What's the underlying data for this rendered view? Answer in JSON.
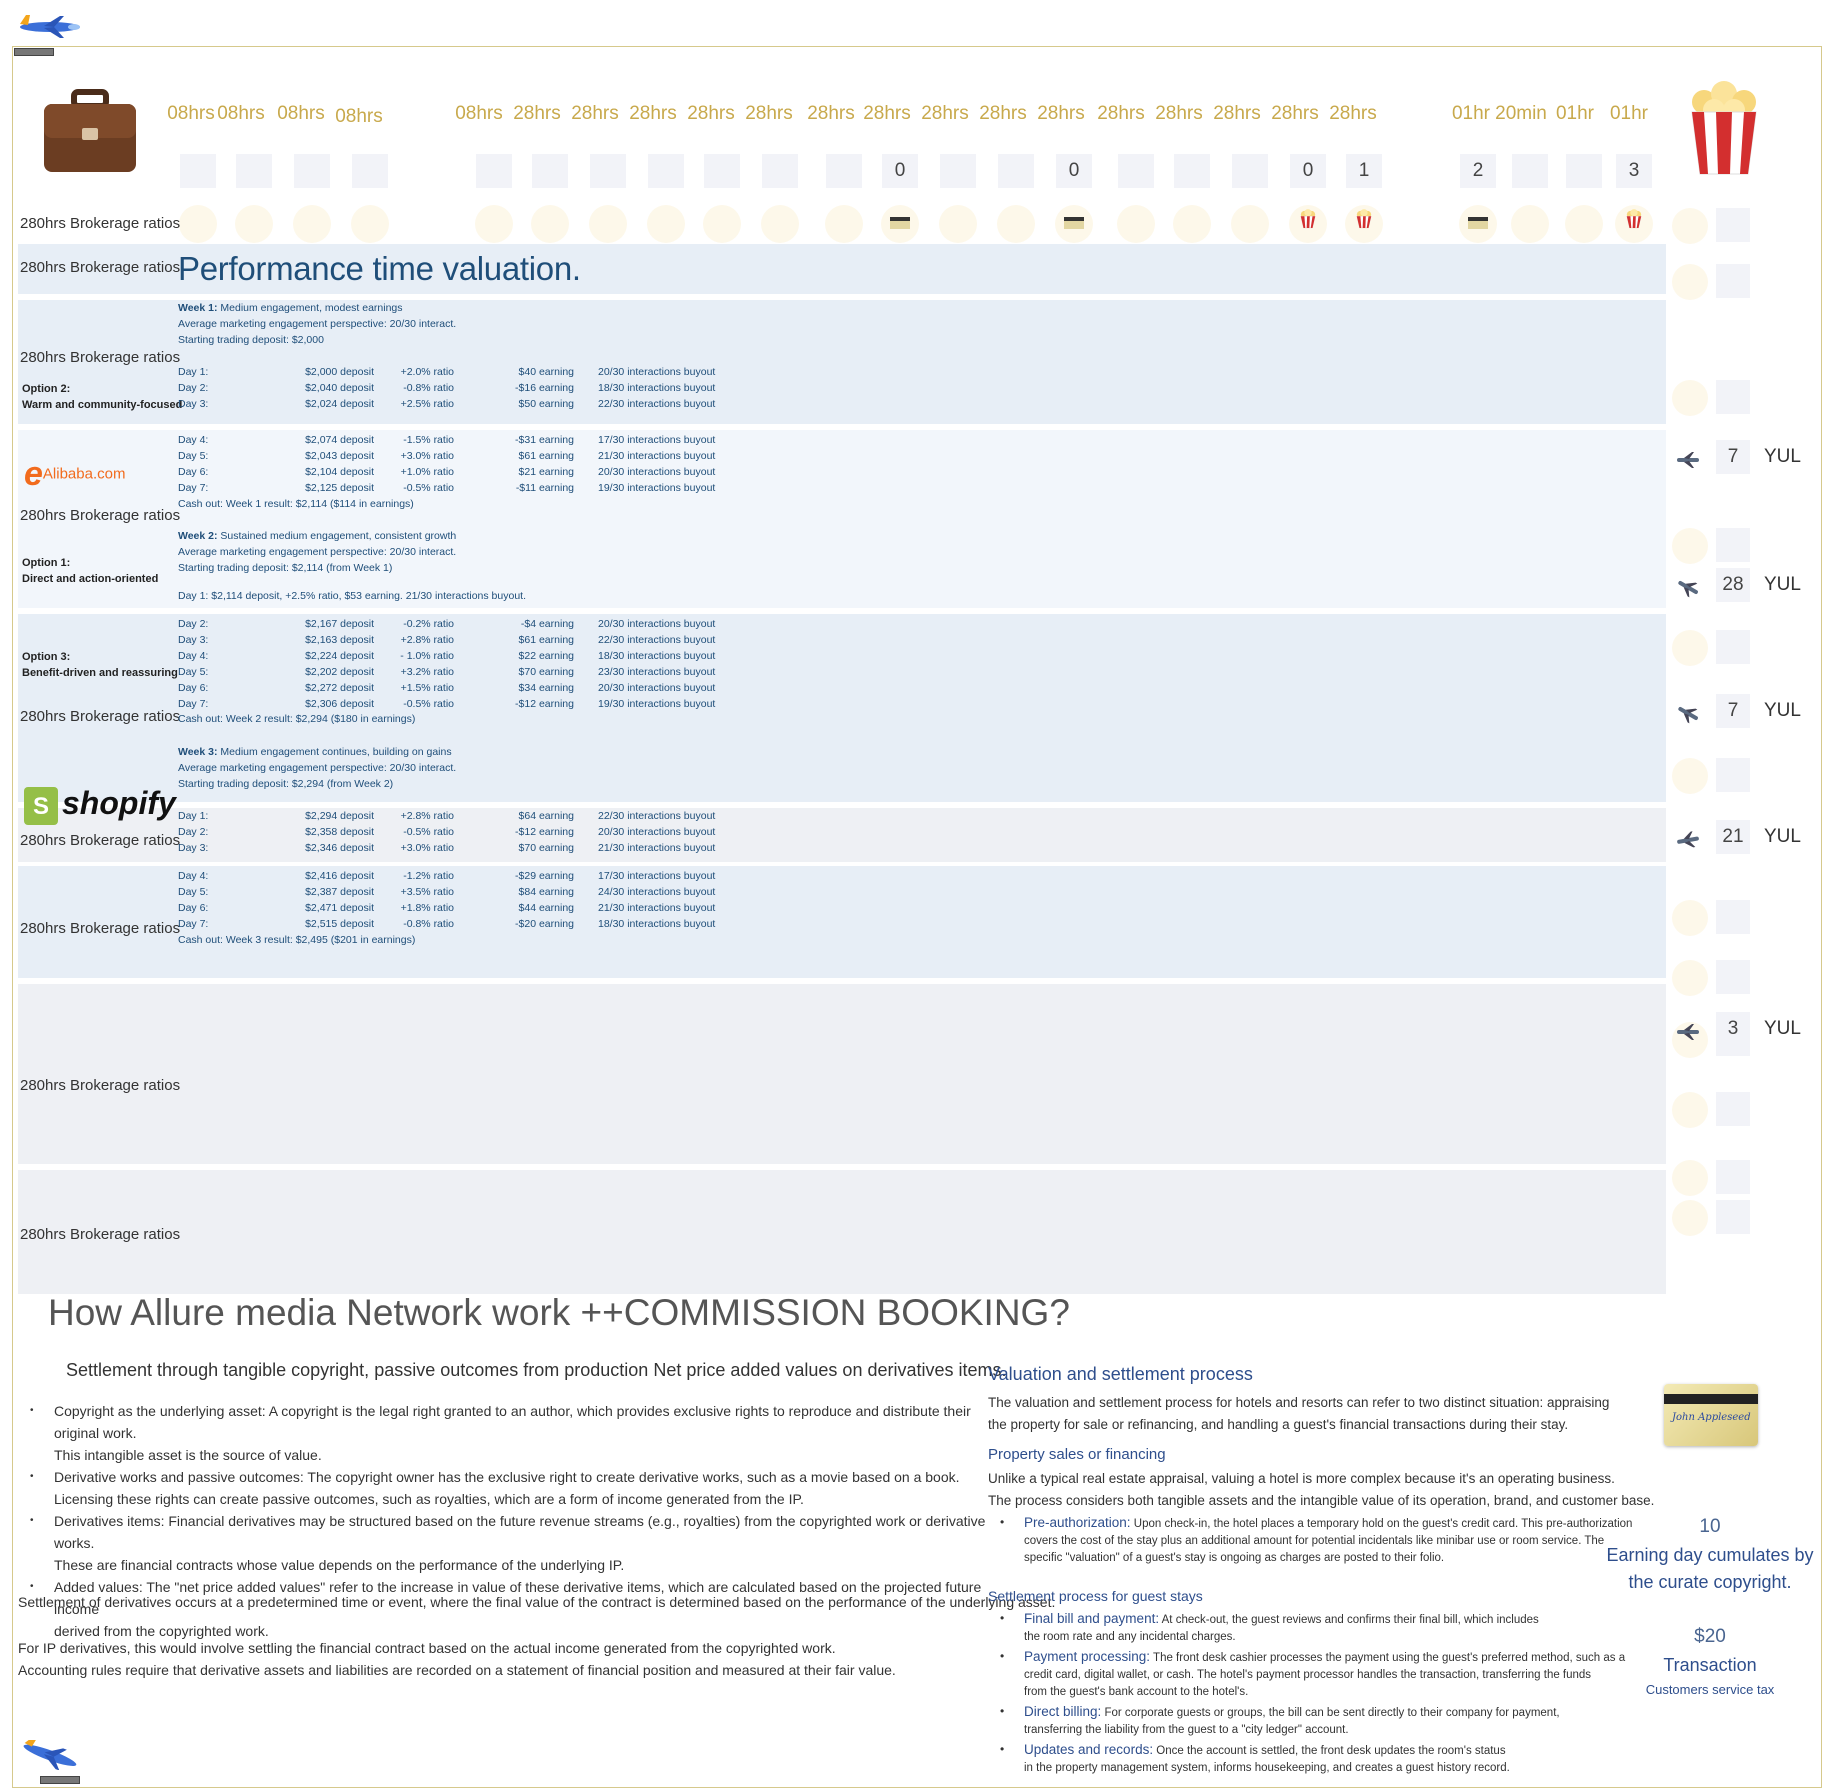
{
  "header": {
    "hours": [
      "08hrs",
      "08hrs",
      "08hrs",
      "08hrs",
      "08hrs",
      "28hrs",
      "28hrs",
      "28hrs",
      "28hrs",
      "28hrs",
      "28hrs",
      "28hrs",
      "28hrs",
      "28hrs",
      "28hrs",
      "28hrs",
      "28hrs",
      "28hrs",
      "28hrs",
      "28hrs",
      "01hr",
      "20min",
      "01hr",
      "01hr"
    ],
    "counters": [
      "0",
      "0",
      "0",
      "1",
      "2",
      "3"
    ],
    "briefcase_icon": "briefcase-icon",
    "popcorn_icon": "popcorn-icon"
  },
  "row_label": "280hrs Brokerage ratios",
  "options": {
    "opt2": {
      "title": "Option 2:",
      "desc": "Warm and community-focused"
    },
    "opt1": {
      "title": "Option 1:",
      "desc": "Direct and action-oriented"
    },
    "opt3": {
      "title": "Option 3:",
      "desc": "Benefit-driven and reassuring"
    }
  },
  "logos": {
    "alibaba": "Alibaba.com",
    "shopify": "shopify"
  },
  "performance_title": "Performance time valuation.",
  "week1": {
    "label": "Week 1:",
    "summary": "Medium engagement, modest earnings",
    "perspective": "Average marketing engagement perspective: 20/30 interact.",
    "deposit": "Starting trading deposit: $2,000",
    "days": [
      {
        "day": "Day 1:",
        "dep": "$2,000 deposit",
        "ratio": "+2.0% ratio",
        "earn": "$40 earning",
        "int": "20/30 interactions buyout"
      },
      {
        "day": "Day 2:",
        "dep": "$2,040 deposit",
        "ratio": "-0.8% ratio",
        "earn": "-$16 earning",
        "int": "18/30 interactions buyout"
      },
      {
        "day": "Day 3:",
        "dep": "$2,024 deposit",
        "ratio": "+2.5% ratio",
        "earn": "$50 earning",
        "int": "22/30 interactions buyout"
      },
      {
        "day": "Day 4:",
        "dep": "$2,074 deposit",
        "ratio": "-1.5% ratio",
        "earn": "-$31 earning",
        "int": "17/30 interactions buyout"
      },
      {
        "day": "Day 5:",
        "dep": "$2,043 deposit",
        "ratio": "+3.0% ratio",
        "earn": "$61 earning",
        "int": "21/30 interactions buyout"
      },
      {
        "day": "Day 6:",
        "dep": "$2,104 deposit",
        "ratio": "+1.0% ratio",
        "earn": "$21 earning",
        "int": "20/30 interactions buyout"
      },
      {
        "day": "Day 7:",
        "dep": "$2,125 deposit",
        "ratio": "-0.5% ratio",
        "earn": "-$11 earning",
        "int": "19/30 interactions buyout"
      }
    ],
    "cashout": "Cash out: Week 1 result: $2,114 ($114 in earnings)"
  },
  "week2": {
    "label": "Week 2:",
    "summary": "Sustained medium engagement, consistent growth",
    "perspective": "Average marketing engagement perspective: 20/30 interact.",
    "deposit": "Starting trading deposit: $2,114 (from Week 1)",
    "day1": "Day 1: $2,114 deposit, +2.5% ratio, $53 earning. 21/30 interactions buyout.",
    "days": [
      {
        "day": "Day 2:",
        "dep": "$2,167 deposit",
        "ratio": "-0.2% ratio",
        "earn": "-$4 earning",
        "int": "20/30 interactions buyout"
      },
      {
        "day": "Day 3:",
        "dep": "$2,163 deposit",
        "ratio": "+2.8% ratio",
        "earn": "$61 earning",
        "int": "22/30 interactions buyout"
      },
      {
        "day": "Day 4:",
        "dep": "$2,224 deposit",
        "ratio": "- 1.0% ratio",
        "earn": "$22 earning",
        "int": "18/30 interactions buyout"
      },
      {
        "day": "Day 5:",
        "dep": "$2,202 deposit",
        "ratio": "+3.2% ratio",
        "earn": "$70 earning",
        "int": "23/30 interactions buyout"
      },
      {
        "day": "Day 6:",
        "dep": "$2,272 deposit",
        "ratio": "+1.5% ratio",
        "earn": "$34 earning",
        "int": "20/30 interactions buyout"
      },
      {
        "day": "Day 7:",
        "dep": "$2,306 deposit",
        "ratio": "-0.5% ratio",
        "earn": "-$12 earning",
        "int": "19/30 interactions buyout"
      }
    ],
    "cashout": "Cash out: Week 2 result: $2,294 ($180 in earnings)"
  },
  "week3": {
    "label": "Week 3:",
    "summary": "Medium engagement continues, building on gains",
    "perspective": "Average marketing engagement perspective: 20/30 interact.",
    "deposit": "Starting trading deposit: $2,294 (from Week 2)",
    "days": [
      {
        "day": "Day 1:",
        "dep": "$2,294 deposit",
        "ratio": "+2.8% ratio",
        "earn": "$64 earning",
        "int": "22/30 interactions buyout"
      },
      {
        "day": "Day 2:",
        "dep": "$2,358 deposit",
        "ratio": "-0.5% ratio",
        "earn": "-$12 earning",
        "int": "20/30 interactions buyout"
      },
      {
        "day": "Day 3:",
        "dep": "$2,346 deposit",
        "ratio": "+3.0% ratio",
        "earn": "$70 earning",
        "int": "21/30 interactions buyout"
      },
      {
        "day": "Day 4:",
        "dep": "$2,416 deposit",
        "ratio": "-1.2% ratio",
        "earn": "-$29 earning",
        "int": "17/30 interactions buyout"
      },
      {
        "day": "Day 5:",
        "dep": "$2,387 deposit",
        "ratio": "+3.5% ratio",
        "earn": "$84 earning",
        "int": "24/30 interactions buyout"
      },
      {
        "day": "Day 6:",
        "dep": "$2,471 deposit",
        "ratio": "+1.8% ratio",
        "earn": "$44 earning",
        "int": "21/30 interactions buyout"
      },
      {
        "day": "Day 7:",
        "dep": "$2,515 deposit",
        "ratio": "-0.8% ratio",
        "earn": "-$20 earning",
        "int": "18/30 interactions buyout"
      }
    ],
    "cashout": "Cash out: Week 3 result: $2,495 ($201 in earnings)"
  },
  "side_flights": [
    {
      "count": "7",
      "city": "YUL"
    },
    {
      "count": "28",
      "city": "YUL"
    },
    {
      "count": "7",
      "city": "YUL"
    },
    {
      "count": "21",
      "city": "YUL"
    },
    {
      "count": "3",
      "city": "YUL"
    }
  ],
  "bottom": {
    "title": "How Allure media Network work ++COMMISSION BOOKING?",
    "subtitle": "Settlement through tangible copyright, passive outcomes from production Net price added values on derivatives items.",
    "bullets": [
      [
        "Copyright as the underlying asset: A copyright is the legal right granted to an author, which provides exclusive rights to reproduce and distribute their original work.",
        "This intangible asset is the source of value."
      ],
      [
        "Derivative works and passive outcomes: The copyright owner has the exclusive right to create derivative works, such as a movie based on a book.",
        "Licensing these rights can create passive outcomes, such as royalties, which are a form of income generated from the IP."
      ],
      [
        "Derivatives items: Financial derivatives may be structured based on the future revenue streams (e.g., royalties) from the copyrighted work or derivative works.",
        "These are financial contracts whose value depends on the performance of the underlying IP."
      ],
      [
        "Added values: The \"net price added values\" refer to the increase in value of these derivative items, which are calculated based on the projected future income",
        "derived from the copyrighted work."
      ]
    ],
    "para1": "Settlement of derivatives occurs at a predetermined time or event, where the final value of the contract is determined based on the performance of the underlying asset.",
    "para2": "For IP derivatives, this would involve settling the financial contract based on the actual income generated from the copyrighted work.",
    "para3": "Accounting rules require that derivative assets and liabilities are recorded on a statement of financial position and measured at their fair value."
  },
  "right": {
    "h1": "Valuation and settlement process",
    "p1a": "The valuation and settlement process for hotels and resorts can refer to two distinct situation: appraising",
    "p1b": "the property for sale or refinancing, and handling a guest's financial transactions during their stay.",
    "h2": "Property sales or financing",
    "p2a": "Unlike a typical real estate appraisal, valuing a hotel is more complex because it's an operating business.",
    "p2b": "The process considers both tangible assets and the intangible value of its operation, brand, and customer base.",
    "list1": [
      {
        "k": "Pre-authorization:",
        "v1": " Upon check-in, the hotel places a temporary hold on the guest's credit card. This pre-authorization",
        "v2": "covers the cost of the stay plus an additional amount for potential incidentals like minibar use or room service. The",
        "v3": "specific \"valuation\" of a guest's stay is ongoing as charges are posted to their folio."
      }
    ],
    "h3": "Settlement process for guest stays",
    "list2": [
      {
        "k": "Final bill and payment:",
        "v1": " At check-out, the guest reviews and confirms their final bill, which includes",
        "v2": "the room rate and any incidental charges.",
        "v3": ""
      },
      {
        "k": "Payment processing:",
        "v1": " The front desk cashier processes the payment using the guest's preferred method, such as a",
        "v2": "credit card, digital wallet, or cash. The hotel's payment processor handles the transaction, transferring the funds",
        "v3": "from the guest's bank account to the hotel's."
      },
      {
        "k": "Direct billing:",
        "v1": " For corporate guests or groups, the bill can be sent directly to their company for payment,",
        "v2": "transferring the liability from the guest to a \"city ledger\" account.",
        "v3": ""
      },
      {
        "k": "Updates and records:",
        "v1": " Once the account is settled, the front desk updates the room's status",
        "v2": "in the property management system, informs housekeeping, and creates a guest history record.",
        "v3": ""
      }
    ]
  },
  "stats": {
    "card_signature": "John Appleseed",
    "n1": "10",
    "t1a": "Earning day cumulates by",
    "t1b": "the curate copyright.",
    "n2": "$20",
    "t2": "Transaction",
    "t2s": "Customers service tax"
  }
}
